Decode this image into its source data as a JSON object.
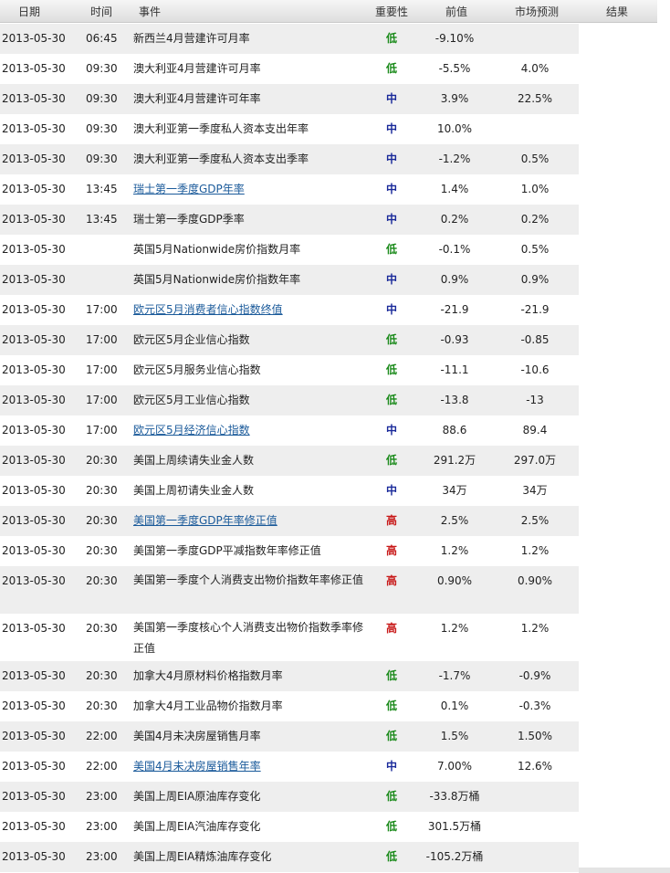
{
  "header": {
    "date": "日期",
    "time": "时间",
    "event": "事件",
    "importance": "重要性",
    "previous": "前值",
    "forecast": "市场预测",
    "result": "结果"
  },
  "colors": {
    "low": "#1a8a1a",
    "mid": "#1a2a9a",
    "high": "#c81818",
    "link": "#1a5a9a"
  },
  "rows": [
    {
      "date": "2013-05-30",
      "time": "06:45",
      "event": "新西兰4月营建许可月率",
      "importance": "低",
      "previous": "-9.10%",
      "forecast": ""
    },
    {
      "date": "2013-05-30",
      "time": "09:30",
      "event": "澳大利亚4月营建许可月率",
      "importance": "低",
      "previous": "-5.5%",
      "forecast": "4.0%"
    },
    {
      "date": "2013-05-30",
      "time": "09:30",
      "event": "澳大利亚4月营建许可年率",
      "importance": "中",
      "previous": "3.9%",
      "forecast": "22.5%"
    },
    {
      "date": "2013-05-30",
      "time": "09:30",
      "event": "澳大利亚第一季度私人资本支出年率",
      "importance": "中",
      "previous": "10.0%",
      "forecast": ""
    },
    {
      "date": "2013-05-30",
      "time": "09:30",
      "event": "澳大利亚第一季度私人资本支出季率",
      "importance": "中",
      "previous": "-1.2%",
      "forecast": "0.5%"
    },
    {
      "date": "2013-05-30",
      "time": "13:45",
      "event": "瑞士第一季度GDP年率",
      "importance": "中",
      "previous": "1.4%",
      "forecast": "1.0%"
    },
    {
      "date": "2013-05-30",
      "time": "13:45",
      "event": "瑞士第一季度GDP季率",
      "importance": "中",
      "previous": "0.2%",
      "forecast": "0.2%"
    },
    {
      "date": "2013-05-30",
      "time": "",
      "event": "英国5月Nationwide房价指数月率",
      "importance": "低",
      "previous": "-0.1%",
      "forecast": "0.5%"
    },
    {
      "date": "2013-05-30",
      "time": "",
      "event": "英国5月Nationwide房价指数年率",
      "importance": "中",
      "previous": "0.9%",
      "forecast": "0.9%"
    },
    {
      "date": "2013-05-30",
      "time": "17:00",
      "event": "欧元区5月消费者信心指数终值",
      "importance": "中",
      "previous": "-21.9",
      "forecast": "-21.9"
    },
    {
      "date": "2013-05-30",
      "time": "17:00",
      "event": "欧元区5月企业信心指数",
      "importance": "低",
      "previous": "-0.93",
      "forecast": "-0.85"
    },
    {
      "date": "2013-05-30",
      "time": "17:00",
      "event": "欧元区5月服务业信心指数",
      "importance": "低",
      "previous": "-11.1",
      "forecast": "-10.6"
    },
    {
      "date": "2013-05-30",
      "time": "17:00",
      "event": "欧元区5月工业信心指数",
      "importance": "低",
      "previous": "-13.8",
      "forecast": "-13"
    },
    {
      "date": "2013-05-30",
      "time": "17:00",
      "event": "欧元区5月经济信心指数",
      "importance": "中",
      "previous": "88.6",
      "forecast": "89.4"
    },
    {
      "date": "2013-05-30",
      "time": "20:30",
      "event": "美国上周续请失业金人数",
      "importance": "低",
      "previous": "291.2万",
      "forecast": "297.0万"
    },
    {
      "date": "2013-05-30",
      "time": "20:30",
      "event": "美国上周初请失业金人数",
      "importance": "中",
      "previous": "34万",
      "forecast": "34万"
    },
    {
      "date": "2013-05-30",
      "time": "20:30",
      "event": "美国第一季度GDP年率修正值",
      "importance": "高",
      "previous": "2.5%",
      "forecast": "2.5%"
    },
    {
      "date": "2013-05-30",
      "time": "20:30",
      "event": "美国第一季度GDP平减指数年率修正值",
      "importance": "高",
      "previous": "1.2%",
      "forecast": "1.2%"
    },
    {
      "date": "2013-05-30",
      "time": "20:30",
      "event": "美国第一季度个人消费支出物价指数年率修正值",
      "importance": "高",
      "previous": "0.90%",
      "forecast": "0.90%"
    },
    {
      "date": "2013-05-30",
      "time": "20:30",
      "event": "美国第一季度核心个人消费支出物价指数季率修正值",
      "importance": "高",
      "previous": "1.2%",
      "forecast": "1.2%"
    },
    {
      "date": "2013-05-30",
      "time": "20:30",
      "event": "加拿大4月原材料价格指数月率",
      "importance": "低",
      "previous": "-1.7%",
      "forecast": "-0.9%"
    },
    {
      "date": "2013-05-30",
      "time": "20:30",
      "event": "加拿大4月工业品物价指数月率",
      "importance": "低",
      "previous": "0.1%",
      "forecast": "-0.3%"
    },
    {
      "date": "2013-05-30",
      "time": "22:00",
      "event": "美国4月未决房屋销售月率",
      "importance": "低",
      "previous": "1.5%",
      "forecast": "1.50%"
    },
    {
      "date": "2013-05-30",
      "time": "22:00",
      "event": "美国4月未决房屋销售年率",
      "importance": "中",
      "previous": "7.00%",
      "forecast": "12.6%"
    },
    {
      "date": "2013-05-30",
      "time": "23:00",
      "event": "美国上周EIA原油库存变化",
      "importance": "低",
      "previous": "-33.8万桶",
      "forecast": ""
    },
    {
      "date": "2013-05-30",
      "time": "23:00",
      "event": "美国上周EIA汽油库存变化",
      "importance": "低",
      "previous": "301.5万桶",
      "forecast": ""
    },
    {
      "date": "2013-05-30",
      "time": "23:00",
      "event": "美国上周EIA精炼油库存变化",
      "importance": "低",
      "previous": "-105.2万桶",
      "forecast": ""
    }
  ]
}
